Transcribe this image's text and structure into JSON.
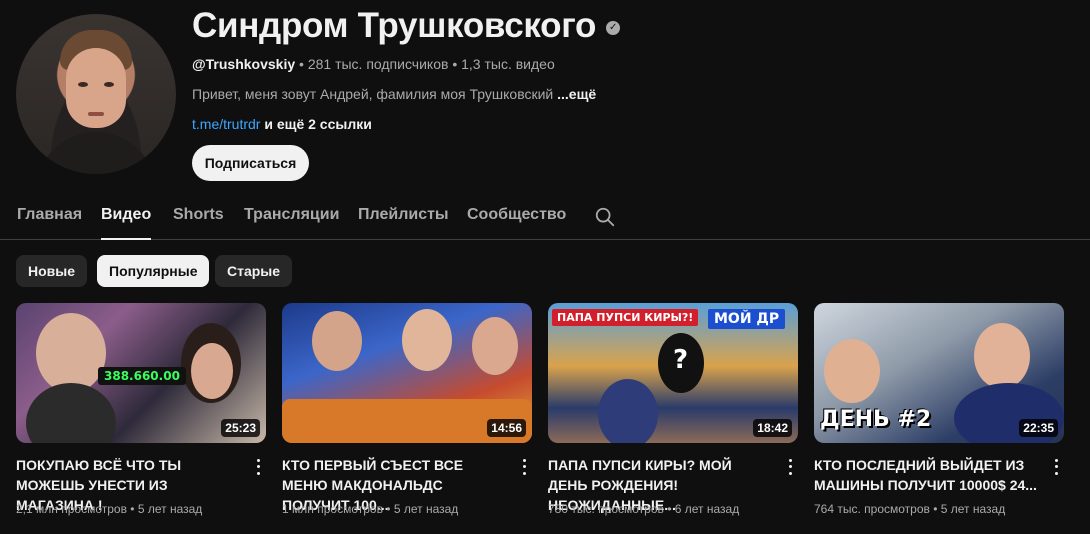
{
  "channel": {
    "title": "Синдром Трушковского",
    "verified_icon": "verified-check-icon",
    "handle": "@Trushkovskiy",
    "subscribers": "281 тыс. подписчиков",
    "videos_count": "1,3 тыс. видео",
    "separator": "•",
    "description": "Привет, меня зовут Андрей, фамилия моя Трушковский",
    "more_label": "...ещё",
    "link_text": "t.me/trutrdr",
    "more_links": "и ещё 2 ссылки",
    "subscribe_label": "Подписаться"
  },
  "tabs": [
    "Главная",
    "Видео",
    "Shorts",
    "Трансляции",
    "Плейлисты",
    "Сообщество"
  ],
  "active_tab": "Видео",
  "chips": [
    "Новые",
    "Популярные",
    "Старые"
  ],
  "active_chip": "Популярные",
  "videos": [
    {
      "title": "ПОКУПАЮ ВСЁ ЧТО ТЫ МОЖЕШЬ УНЕСТИ ИЗ МАГАЗИНА !",
      "duration": "25:23",
      "views": "2,1 млн просмотров",
      "age": "5 лет назад",
      "thumb_text": "388.660.00"
    },
    {
      "title": "КТО ПЕРВЫЙ СЪЕСТ ВСЕ МЕНЮ МАКДОНАЛЬДС ПОЛУЧИТ 100...",
      "duration": "14:56",
      "views": "1 млн просмотров",
      "age": "5 лет назад"
    },
    {
      "title": "ПАПА ПУПСИ КИРЫ? МОЙ ДЕНЬ РОЖДЕНИЯ! НЕОЖИДАННЫЕ...",
      "duration": "18:42",
      "views": "780 тыс. просмотров",
      "age": "6 лет назад",
      "thumb_text_left": "ПАПА ПУПСИ КИРЫ?!",
      "thumb_text_right": "МОЙ ДР"
    },
    {
      "title": "КТО ПОСЛЕДНИЙ ВЫЙДЕТ ИЗ МАШИНЫ ПОЛУЧИТ 10000$ 24...",
      "duration": "22:35",
      "views": "764 тыс. просмотров",
      "age": "5 лет назад",
      "thumb_text": "ДЕНЬ #2"
    }
  ],
  "colors": {
    "background": "#0f0f0f",
    "text_primary": "#f1f1f1",
    "text_secondary": "#aaaaaa",
    "link": "#3ea6ff",
    "chip_bg": "#272727"
  }
}
